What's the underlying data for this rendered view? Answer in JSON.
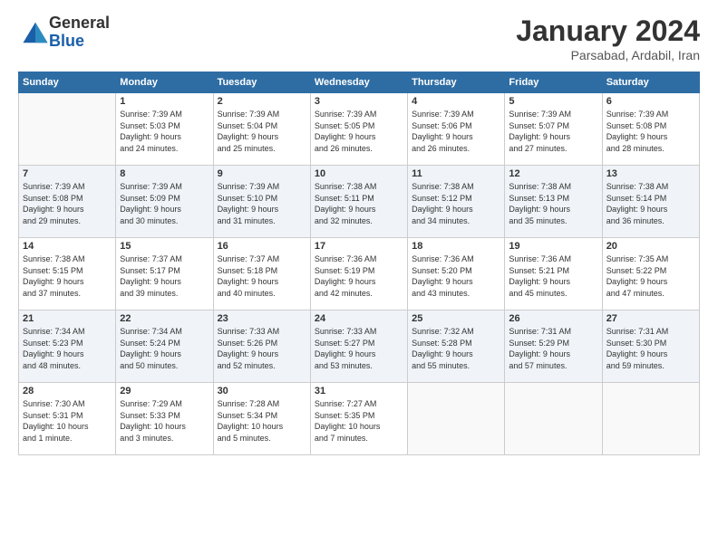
{
  "logo": {
    "general": "General",
    "blue": "Blue"
  },
  "title": "January 2024",
  "location": "Parsabad, Ardabil, Iran",
  "weekdays": [
    "Sunday",
    "Monday",
    "Tuesday",
    "Wednesday",
    "Thursday",
    "Friday",
    "Saturday"
  ],
  "weeks": [
    [
      {
        "day": "",
        "info": ""
      },
      {
        "day": "1",
        "info": "Sunrise: 7:39 AM\nSunset: 5:03 PM\nDaylight: 9 hours\nand 24 minutes."
      },
      {
        "day": "2",
        "info": "Sunrise: 7:39 AM\nSunset: 5:04 PM\nDaylight: 9 hours\nand 25 minutes."
      },
      {
        "day": "3",
        "info": "Sunrise: 7:39 AM\nSunset: 5:05 PM\nDaylight: 9 hours\nand 26 minutes."
      },
      {
        "day": "4",
        "info": "Sunrise: 7:39 AM\nSunset: 5:06 PM\nDaylight: 9 hours\nand 26 minutes."
      },
      {
        "day": "5",
        "info": "Sunrise: 7:39 AM\nSunset: 5:07 PM\nDaylight: 9 hours\nand 27 minutes."
      },
      {
        "day": "6",
        "info": "Sunrise: 7:39 AM\nSunset: 5:08 PM\nDaylight: 9 hours\nand 28 minutes."
      }
    ],
    [
      {
        "day": "7",
        "info": "Sunrise: 7:39 AM\nSunset: 5:08 PM\nDaylight: 9 hours\nand 29 minutes."
      },
      {
        "day": "8",
        "info": "Sunrise: 7:39 AM\nSunset: 5:09 PM\nDaylight: 9 hours\nand 30 minutes."
      },
      {
        "day": "9",
        "info": "Sunrise: 7:39 AM\nSunset: 5:10 PM\nDaylight: 9 hours\nand 31 minutes."
      },
      {
        "day": "10",
        "info": "Sunrise: 7:38 AM\nSunset: 5:11 PM\nDaylight: 9 hours\nand 32 minutes."
      },
      {
        "day": "11",
        "info": "Sunrise: 7:38 AM\nSunset: 5:12 PM\nDaylight: 9 hours\nand 34 minutes."
      },
      {
        "day": "12",
        "info": "Sunrise: 7:38 AM\nSunset: 5:13 PM\nDaylight: 9 hours\nand 35 minutes."
      },
      {
        "day": "13",
        "info": "Sunrise: 7:38 AM\nSunset: 5:14 PM\nDaylight: 9 hours\nand 36 minutes."
      }
    ],
    [
      {
        "day": "14",
        "info": "Sunrise: 7:38 AM\nSunset: 5:15 PM\nDaylight: 9 hours\nand 37 minutes."
      },
      {
        "day": "15",
        "info": "Sunrise: 7:37 AM\nSunset: 5:17 PM\nDaylight: 9 hours\nand 39 minutes."
      },
      {
        "day": "16",
        "info": "Sunrise: 7:37 AM\nSunset: 5:18 PM\nDaylight: 9 hours\nand 40 minutes."
      },
      {
        "day": "17",
        "info": "Sunrise: 7:36 AM\nSunset: 5:19 PM\nDaylight: 9 hours\nand 42 minutes."
      },
      {
        "day": "18",
        "info": "Sunrise: 7:36 AM\nSunset: 5:20 PM\nDaylight: 9 hours\nand 43 minutes."
      },
      {
        "day": "19",
        "info": "Sunrise: 7:36 AM\nSunset: 5:21 PM\nDaylight: 9 hours\nand 45 minutes."
      },
      {
        "day": "20",
        "info": "Sunrise: 7:35 AM\nSunset: 5:22 PM\nDaylight: 9 hours\nand 47 minutes."
      }
    ],
    [
      {
        "day": "21",
        "info": "Sunrise: 7:34 AM\nSunset: 5:23 PM\nDaylight: 9 hours\nand 48 minutes."
      },
      {
        "day": "22",
        "info": "Sunrise: 7:34 AM\nSunset: 5:24 PM\nDaylight: 9 hours\nand 50 minutes."
      },
      {
        "day": "23",
        "info": "Sunrise: 7:33 AM\nSunset: 5:26 PM\nDaylight: 9 hours\nand 52 minutes."
      },
      {
        "day": "24",
        "info": "Sunrise: 7:33 AM\nSunset: 5:27 PM\nDaylight: 9 hours\nand 53 minutes."
      },
      {
        "day": "25",
        "info": "Sunrise: 7:32 AM\nSunset: 5:28 PM\nDaylight: 9 hours\nand 55 minutes."
      },
      {
        "day": "26",
        "info": "Sunrise: 7:31 AM\nSunset: 5:29 PM\nDaylight: 9 hours\nand 57 minutes."
      },
      {
        "day": "27",
        "info": "Sunrise: 7:31 AM\nSunset: 5:30 PM\nDaylight: 9 hours\nand 59 minutes."
      }
    ],
    [
      {
        "day": "28",
        "info": "Sunrise: 7:30 AM\nSunset: 5:31 PM\nDaylight: 10 hours\nand 1 minute."
      },
      {
        "day": "29",
        "info": "Sunrise: 7:29 AM\nSunset: 5:33 PM\nDaylight: 10 hours\nand 3 minutes."
      },
      {
        "day": "30",
        "info": "Sunrise: 7:28 AM\nSunset: 5:34 PM\nDaylight: 10 hours\nand 5 minutes."
      },
      {
        "day": "31",
        "info": "Sunrise: 7:27 AM\nSunset: 5:35 PM\nDaylight: 10 hours\nand 7 minutes."
      },
      {
        "day": "",
        "info": ""
      },
      {
        "day": "",
        "info": ""
      },
      {
        "day": "",
        "info": ""
      }
    ]
  ],
  "row_shades": [
    "white",
    "shade",
    "white",
    "shade",
    "white"
  ]
}
